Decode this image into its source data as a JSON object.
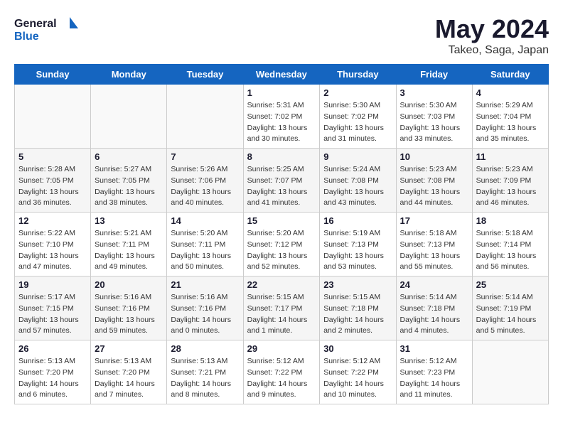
{
  "header": {
    "logo_line1": "General",
    "logo_line2": "Blue",
    "month_title": "May 2024",
    "location": "Takeo, Saga, Japan"
  },
  "days_of_week": [
    "Sunday",
    "Monday",
    "Tuesday",
    "Wednesday",
    "Thursday",
    "Friday",
    "Saturday"
  ],
  "weeks": [
    [
      {
        "day": "",
        "sunrise": "",
        "sunset": "",
        "daylight": ""
      },
      {
        "day": "",
        "sunrise": "",
        "sunset": "",
        "daylight": ""
      },
      {
        "day": "",
        "sunrise": "",
        "sunset": "",
        "daylight": ""
      },
      {
        "day": "1",
        "sunrise": "Sunrise: 5:31 AM",
        "sunset": "Sunset: 7:02 PM",
        "daylight": "Daylight: 13 hours and 30 minutes."
      },
      {
        "day": "2",
        "sunrise": "Sunrise: 5:30 AM",
        "sunset": "Sunset: 7:02 PM",
        "daylight": "Daylight: 13 hours and 31 minutes."
      },
      {
        "day": "3",
        "sunrise": "Sunrise: 5:30 AM",
        "sunset": "Sunset: 7:03 PM",
        "daylight": "Daylight: 13 hours and 33 minutes."
      },
      {
        "day": "4",
        "sunrise": "Sunrise: 5:29 AM",
        "sunset": "Sunset: 7:04 PM",
        "daylight": "Daylight: 13 hours and 35 minutes."
      }
    ],
    [
      {
        "day": "5",
        "sunrise": "Sunrise: 5:28 AM",
        "sunset": "Sunset: 7:05 PM",
        "daylight": "Daylight: 13 hours and 36 minutes."
      },
      {
        "day": "6",
        "sunrise": "Sunrise: 5:27 AM",
        "sunset": "Sunset: 7:05 PM",
        "daylight": "Daylight: 13 hours and 38 minutes."
      },
      {
        "day": "7",
        "sunrise": "Sunrise: 5:26 AM",
        "sunset": "Sunset: 7:06 PM",
        "daylight": "Daylight: 13 hours and 40 minutes."
      },
      {
        "day": "8",
        "sunrise": "Sunrise: 5:25 AM",
        "sunset": "Sunset: 7:07 PM",
        "daylight": "Daylight: 13 hours and 41 minutes."
      },
      {
        "day": "9",
        "sunrise": "Sunrise: 5:24 AM",
        "sunset": "Sunset: 7:08 PM",
        "daylight": "Daylight: 13 hours and 43 minutes."
      },
      {
        "day": "10",
        "sunrise": "Sunrise: 5:23 AM",
        "sunset": "Sunset: 7:08 PM",
        "daylight": "Daylight: 13 hours and 44 minutes."
      },
      {
        "day": "11",
        "sunrise": "Sunrise: 5:23 AM",
        "sunset": "Sunset: 7:09 PM",
        "daylight": "Daylight: 13 hours and 46 minutes."
      }
    ],
    [
      {
        "day": "12",
        "sunrise": "Sunrise: 5:22 AM",
        "sunset": "Sunset: 7:10 PM",
        "daylight": "Daylight: 13 hours and 47 minutes."
      },
      {
        "day": "13",
        "sunrise": "Sunrise: 5:21 AM",
        "sunset": "Sunset: 7:11 PM",
        "daylight": "Daylight: 13 hours and 49 minutes."
      },
      {
        "day": "14",
        "sunrise": "Sunrise: 5:20 AM",
        "sunset": "Sunset: 7:11 PM",
        "daylight": "Daylight: 13 hours and 50 minutes."
      },
      {
        "day": "15",
        "sunrise": "Sunrise: 5:20 AM",
        "sunset": "Sunset: 7:12 PM",
        "daylight": "Daylight: 13 hours and 52 minutes."
      },
      {
        "day": "16",
        "sunrise": "Sunrise: 5:19 AM",
        "sunset": "Sunset: 7:13 PM",
        "daylight": "Daylight: 13 hours and 53 minutes."
      },
      {
        "day": "17",
        "sunrise": "Sunrise: 5:18 AM",
        "sunset": "Sunset: 7:13 PM",
        "daylight": "Daylight: 13 hours and 55 minutes."
      },
      {
        "day": "18",
        "sunrise": "Sunrise: 5:18 AM",
        "sunset": "Sunset: 7:14 PM",
        "daylight": "Daylight: 13 hours and 56 minutes."
      }
    ],
    [
      {
        "day": "19",
        "sunrise": "Sunrise: 5:17 AM",
        "sunset": "Sunset: 7:15 PM",
        "daylight": "Daylight: 13 hours and 57 minutes."
      },
      {
        "day": "20",
        "sunrise": "Sunrise: 5:16 AM",
        "sunset": "Sunset: 7:16 PM",
        "daylight": "Daylight: 13 hours and 59 minutes."
      },
      {
        "day": "21",
        "sunrise": "Sunrise: 5:16 AM",
        "sunset": "Sunset: 7:16 PM",
        "daylight": "Daylight: 14 hours and 0 minutes."
      },
      {
        "day": "22",
        "sunrise": "Sunrise: 5:15 AM",
        "sunset": "Sunset: 7:17 PM",
        "daylight": "Daylight: 14 hours and 1 minute."
      },
      {
        "day": "23",
        "sunrise": "Sunrise: 5:15 AM",
        "sunset": "Sunset: 7:18 PM",
        "daylight": "Daylight: 14 hours and 2 minutes."
      },
      {
        "day": "24",
        "sunrise": "Sunrise: 5:14 AM",
        "sunset": "Sunset: 7:18 PM",
        "daylight": "Daylight: 14 hours and 4 minutes."
      },
      {
        "day": "25",
        "sunrise": "Sunrise: 5:14 AM",
        "sunset": "Sunset: 7:19 PM",
        "daylight": "Daylight: 14 hours and 5 minutes."
      }
    ],
    [
      {
        "day": "26",
        "sunrise": "Sunrise: 5:13 AM",
        "sunset": "Sunset: 7:20 PM",
        "daylight": "Daylight: 14 hours and 6 minutes."
      },
      {
        "day": "27",
        "sunrise": "Sunrise: 5:13 AM",
        "sunset": "Sunset: 7:20 PM",
        "daylight": "Daylight: 14 hours and 7 minutes."
      },
      {
        "day": "28",
        "sunrise": "Sunrise: 5:13 AM",
        "sunset": "Sunset: 7:21 PM",
        "daylight": "Daylight: 14 hours and 8 minutes."
      },
      {
        "day": "29",
        "sunrise": "Sunrise: 5:12 AM",
        "sunset": "Sunset: 7:22 PM",
        "daylight": "Daylight: 14 hours and 9 minutes."
      },
      {
        "day": "30",
        "sunrise": "Sunrise: 5:12 AM",
        "sunset": "Sunset: 7:22 PM",
        "daylight": "Daylight: 14 hours and 10 minutes."
      },
      {
        "day": "31",
        "sunrise": "Sunrise: 5:12 AM",
        "sunset": "Sunset: 7:23 PM",
        "daylight": "Daylight: 14 hours and 11 minutes."
      },
      {
        "day": "",
        "sunrise": "",
        "sunset": "",
        "daylight": ""
      }
    ]
  ]
}
